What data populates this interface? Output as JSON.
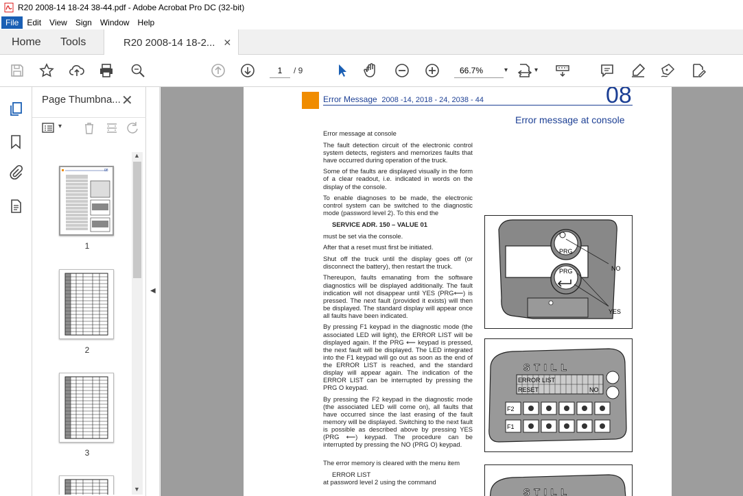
{
  "window": {
    "title": "R20 2008-14 18-24 38-44.pdf - Adobe Acrobat Pro DC (32-bit)"
  },
  "menu": [
    "File",
    "Edit",
    "View",
    "Sign",
    "Window",
    "Help"
  ],
  "tabs": {
    "home": "Home",
    "tools": "Tools",
    "document": "R20 2008-14 18-2...",
    "close": "✕"
  },
  "toolbar": {
    "page_current": "1",
    "page_total": "/ 9",
    "zoom": "66.7%"
  },
  "panel": {
    "title": "Page Thumbna...",
    "close": "✕",
    "thumbnails": [
      {
        "label": "1"
      },
      {
        "label": "2"
      },
      {
        "label": "3"
      }
    ]
  },
  "document": {
    "header_title": "Error Message",
    "header_sub": "2008 -14, 2018 - 24, 2038 - 44",
    "header_number": "08",
    "section_title": "Error message at console",
    "paragraphs": [
      "Error message at console",
      "The fault detection circuit of the electronic control system detects, registers and memorizes faults that have occurred during operation of the truck.",
      "Some of the faults are displayed visually in the form of a clear readout, i.e. indicated in words on the display of the console.",
      "To enable diagnoses to be made, the electronic control system can be switched to the diagnostic mode (password level 2). To this end the",
      "SERVICE ADR. 150 – VALUE 01",
      "must be set via the console.",
      "After that a reset must first be initiated.",
      "Shut off the truck until the display goes off (or disconnect the battery), then restart the truck.",
      "Thereupon, faults emanating from the software diagnostics will be displayed additionally. The fault indication will not disappear until YES (PRG⟵) is pressed. The next fault (provided it exists) will then be displayed. The standard display will appear once all faults have been indicated.",
      "By pressing F1 keypad in the diagnostic mode (the associated LED will light), the ERROR LIST will be displayed again. If the PRG ⟵ keypad is pressed, the next fault will be displayed. The LED integrated into the F1 keypad will go out as soon as the end of the ERROR LIST is reached, and the standard display will appear again. The indication of the ERROR LIST can be interrupted by pressing the PRG O keypad.",
      "By pressing the F2 keypad in the diagnostic mode (the associated LED will come on), all faults that have occurred since the last erasing of the fault memory will be displayed. Switching to the next fault is possible as described above by pressing YES (PRG ⟵) keypad. The procedure can be interrupted by pressing the NO (PRG O) keypad.",
      "The error memory is cleared with the menu item",
      "ERROR LIST",
      "at password level 2 using the command"
    ],
    "figure1": {
      "prg_top": "PRG",
      "prg_bottom": "PRG",
      "no": "NO",
      "yes": "YES"
    },
    "figure2": {
      "brand": "STILL",
      "line1": "ERROR LIST",
      "line2": "RESET",
      "line2_right": "NO",
      "f2": "F2",
      "f1": "F1"
    },
    "figure3": {
      "brand": "STILL"
    }
  },
  "colors": {
    "accent_orange": "#f08c00",
    "doc_blue": "#1c3f94",
    "menu_active": "#1a5fb4"
  }
}
